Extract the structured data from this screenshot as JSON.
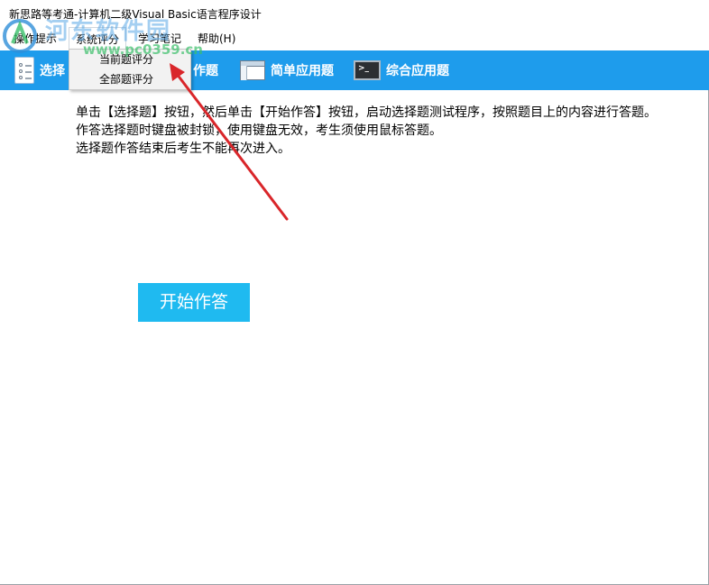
{
  "window": {
    "title": "新思路等考通-计算机二级Visual  Basic语言程序设计"
  },
  "menubar": {
    "items": [
      {
        "label": "操作提示"
      },
      {
        "label": "系统评分"
      },
      {
        "label": "学习笔记"
      },
      {
        "label": "帮助(H)"
      }
    ]
  },
  "dropdown": {
    "items": [
      {
        "label": "当前题评分"
      },
      {
        "label": "全部题评分"
      }
    ]
  },
  "toolbar": {
    "items": [
      {
        "label": "选择",
        "icon": "list-icon"
      },
      {
        "label": "作题",
        "icon": ""
      },
      {
        "label": "简单应用题",
        "icon": "window-icon"
      },
      {
        "label": "综合应用题",
        "icon": "terminal-icon"
      }
    ],
    "background": "#1e9cec"
  },
  "content": {
    "paragraphs": [
      "单击【选择题】按钮，然后单击【开始作答】按钮，启动选择题测试程序，按照题目上的内容进行答题。",
      "作答选择题时键盘被封锁，使用键盘无效，考生须使用鼠标答题。",
      "选择题作答结束后考生不能再次进入。"
    ]
  },
  "start_button": {
    "label": "开始作答",
    "color": "#1fbaf0"
  },
  "watermark": {
    "site": "河东软件园",
    "url": "www.pc0359.cn"
  },
  "annotation": {
    "arrow_color": "#d9262a"
  }
}
